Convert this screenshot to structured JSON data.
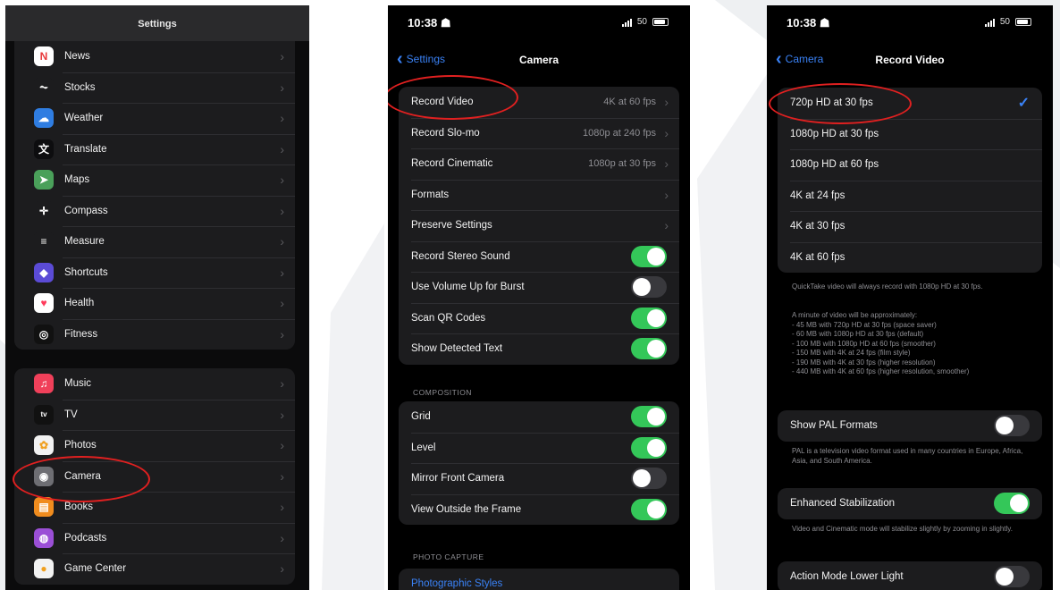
{
  "colors": {
    "ios_blue": "#3a82f6",
    "ios_green": "#34c759",
    "annotation_red": "#e02020"
  },
  "screen1": {
    "title": "Settings",
    "group1": [
      {
        "label": "News",
        "icon": "news-icon",
        "color": "#ffffff",
        "glyph": "N"
      },
      {
        "label": "Stocks",
        "icon": "stocks-icon",
        "color": "#1c1c1e",
        "glyph": "⏦"
      },
      {
        "label": "Weather",
        "icon": "weather-icon",
        "color": "#2f7de1",
        "glyph": "☁"
      },
      {
        "label": "Translate",
        "icon": "translate-icon",
        "color": "#0d0d0f",
        "glyph": "文"
      },
      {
        "label": "Maps",
        "icon": "maps-icon",
        "color": "#4aa05a",
        "glyph": "➤"
      },
      {
        "label": "Compass",
        "icon": "compass-icon",
        "color": "#1c1c1e",
        "glyph": "✛"
      },
      {
        "label": "Measure",
        "icon": "measure-icon",
        "color": "#1c1c1e",
        "glyph": "≡"
      },
      {
        "label": "Shortcuts",
        "icon": "shortcuts-icon",
        "color": "#5b4bd6",
        "glyph": "◆"
      },
      {
        "label": "Health",
        "icon": "health-icon",
        "color": "#ffffff",
        "glyph": "♥"
      },
      {
        "label": "Fitness",
        "icon": "fitness-icon",
        "color": "#111111",
        "glyph": "◎"
      }
    ],
    "group2": [
      {
        "label": "Music",
        "icon": "music-icon",
        "color": "#f0405a",
        "glyph": "♫"
      },
      {
        "label": "TV",
        "icon": "tv-icon",
        "color": "#111111",
        "glyph": "tv"
      },
      {
        "label": "Photos",
        "icon": "photos-icon",
        "color": "#f2f2f2",
        "glyph": "✿"
      },
      {
        "label": "Camera",
        "icon": "camera-icon",
        "color": "#6e6e73",
        "glyph": "◉"
      },
      {
        "label": "Books",
        "icon": "books-icon",
        "color": "#f08c1e",
        "glyph": "▤"
      },
      {
        "label": "Podcasts",
        "icon": "podcasts-icon",
        "color": "#9b4fd6",
        "glyph": "◍"
      },
      {
        "label": "Game Center",
        "icon": "game-center-icon",
        "color": "#f2f2f2",
        "glyph": "●"
      }
    ]
  },
  "screen2": {
    "time": "10:38",
    "battery": "50",
    "back_label": "Settings",
    "title": "Camera",
    "group1": [
      {
        "label": "Record Video",
        "value": "4K at 60 fps",
        "type": "chevron"
      },
      {
        "label": "Record Slo-mo",
        "value": "1080p at 240 fps",
        "type": "chevron"
      },
      {
        "label": "Record Cinematic",
        "value": "1080p at 30 fps",
        "type": "chevron"
      },
      {
        "label": "Formats",
        "value": "",
        "type": "chevron"
      },
      {
        "label": "Preserve Settings",
        "value": "",
        "type": "chevron"
      },
      {
        "label": "Record Stereo Sound",
        "on": true,
        "type": "toggle"
      },
      {
        "label": "Use Volume Up for Burst",
        "on": false,
        "type": "toggle"
      },
      {
        "label": "Scan QR Codes",
        "on": true,
        "type": "toggle"
      },
      {
        "label": "Show Detected Text",
        "on": true,
        "type": "toggle"
      }
    ],
    "composition_header": "COMPOSITION",
    "group2": [
      {
        "label": "Grid",
        "on": true,
        "type": "toggle"
      },
      {
        "label": "Level",
        "on": true,
        "type": "toggle"
      },
      {
        "label": "Mirror Front Camera",
        "on": false,
        "type": "toggle"
      },
      {
        "label": "View Outside the Frame",
        "on": true,
        "type": "toggle"
      }
    ],
    "photo_capture_header": "PHOTO CAPTURE",
    "photographic_styles": "Photographic Styles"
  },
  "screen3": {
    "time": "10:38",
    "battery": "50",
    "back_label": "Camera",
    "title": "Record Video",
    "options": [
      {
        "label": "720p HD at 30 fps",
        "selected": true
      },
      {
        "label": "1080p HD at 30 fps",
        "selected": false
      },
      {
        "label": "1080p HD at 60 fps",
        "selected": false
      },
      {
        "label": "4K at 24 fps",
        "selected": false
      },
      {
        "label": "4K at 30 fps",
        "selected": false
      },
      {
        "label": "4K at 60 fps",
        "selected": false
      }
    ],
    "quicktake_note": "QuickTake video will always record with 1080p HD at 30 fps.",
    "size_note_lines": [
      "A minute of video will be approximately:",
      "- 45 MB with 720p HD at 30 fps (space saver)",
      "- 60 MB with 1080p HD at 30 fps (default)",
      "- 100 MB with 1080p HD at 60 fps (smoother)",
      "- 150 MB with 4K at 24 fps (film style)",
      "- 190 MB with 4K at 30 fps (higher resolution)",
      "- 440 MB with 4K at 60 fps (higher resolution, smoother)"
    ],
    "show_pal_label": "Show PAL Formats",
    "show_pal_on": false,
    "pal_note": "PAL is a television video format used in many countries in Europe, Africa, Asia, and South America.",
    "enhanced_stab_label": "Enhanced Stabilization",
    "enhanced_stab_on": true,
    "stab_note": "Video and Cinematic mode will stabilize slightly by zooming in slightly.",
    "action_mode_label": "Action Mode Lower Light",
    "action_mode_on": false
  }
}
